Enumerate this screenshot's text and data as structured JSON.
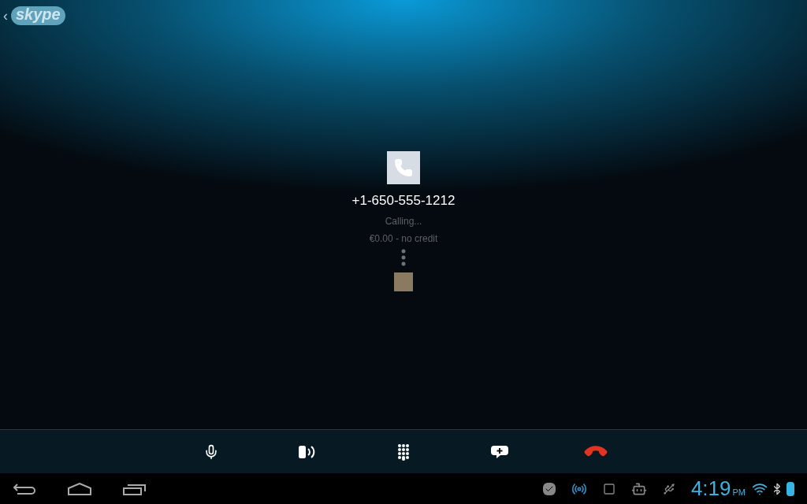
{
  "app_bar": {
    "back": "‹",
    "logo": "skype"
  },
  "call": {
    "number": "+1-650-555-1212",
    "status": "Calling...",
    "credit": "€0.00 - no credit"
  },
  "controls": [
    {
      "kind": "mic"
    },
    {
      "kind": "speaker"
    },
    {
      "kind": "dialpad"
    },
    {
      "kind": "chat"
    },
    {
      "kind": "hangup"
    }
  ],
  "status_bar": {
    "time": "4:19",
    "ampm": "PM",
    "icons": [
      {
        "kind": "skype"
      },
      {
        "kind": "signal"
      },
      {
        "kind": "screenshot"
      },
      {
        "kind": "android"
      },
      {
        "kind": "usb"
      }
    ]
  }
}
